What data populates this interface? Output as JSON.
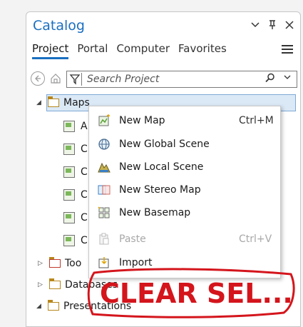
{
  "pane": {
    "title": "Catalog",
    "controls": [
      "chevron-down-icon",
      "pin-icon",
      "close-icon"
    ]
  },
  "tabs": [
    "Project",
    "Portal",
    "Computer",
    "Favorites"
  ],
  "search": {
    "placeholder": "Search Project"
  },
  "tree": {
    "maps_label": "Maps",
    "children_partial": [
      "A",
      "C",
      "C",
      "C",
      "C",
      "C"
    ],
    "toolboxes_label": "Too",
    "databases_label": "Databases",
    "presentations_label": "Presentations"
  },
  "context_menu": {
    "items": [
      {
        "label": "New Map",
        "shortcut": "Ctrl+M",
        "icon": "new-map-icon",
        "enabled": true
      },
      {
        "label": "New Global Scene",
        "shortcut": "",
        "icon": "globe-icon",
        "enabled": true
      },
      {
        "label": "New Local Scene",
        "shortcut": "",
        "icon": "local-scene-icon",
        "enabled": true
      },
      {
        "label": "New Stereo Map",
        "shortcut": "",
        "icon": "stereo-map-icon",
        "enabled": true
      },
      {
        "label": "New Basemap",
        "shortcut": "",
        "icon": "basemap-icon",
        "enabled": true
      },
      {
        "label": "Paste",
        "shortcut": "Ctrl+V",
        "icon": "paste-icon",
        "enabled": false
      },
      {
        "label": "Import",
        "shortcut": "",
        "icon": "import-icon",
        "enabled": true
      }
    ]
  },
  "annotation": {
    "text": "CLEAR SEL...",
    "color": "#d4151c"
  },
  "colors": {
    "accent": "#1a6fc0",
    "selection": "#dbe9f7",
    "folder": "#b8871b"
  }
}
